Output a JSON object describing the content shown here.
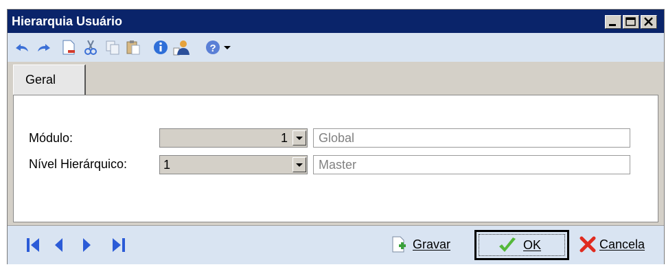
{
  "window": {
    "title": "Hierarquia Usuário"
  },
  "title_buttons": {
    "minimize_icon": "minimize-icon",
    "maximize_icon": "maximize-icon",
    "close_icon": "close-icon"
  },
  "toolbar": {
    "icons": [
      "undo-icon",
      "redo-icon",
      "delete-document-icon",
      "cut-icon",
      "copy-icon",
      "paste-icon",
      "info-icon",
      "user-properties-icon",
      "help-icon",
      "dropdown-arrow-icon"
    ]
  },
  "tabs": [
    {
      "label": "Geral"
    }
  ],
  "form": {
    "modulo": {
      "label": "Módulo:",
      "value": "1",
      "description": "Global"
    },
    "nivel": {
      "label": "Nível Hierárquico:",
      "value": "1",
      "description": "Master"
    }
  },
  "footer": {
    "nav_icons": [
      "first-record-icon",
      "previous-record-icon",
      "next-record-icon",
      "last-record-icon"
    ],
    "save_label": "Gravar",
    "ok_label": "OK",
    "cancel_label": "Cancela"
  },
  "colors": {
    "titlebar": "#0a246a",
    "toolbar": "#d9e4f2",
    "nav_arrows": "#2b5bd7"
  }
}
